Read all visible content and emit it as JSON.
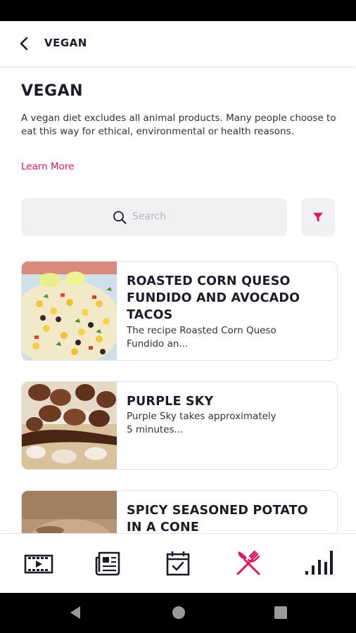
{
  "colors": {
    "accent": "#e0155f",
    "text": "#1b1c2a",
    "muted_field": "#f1f1f3"
  },
  "header": {
    "title": "VEGAN",
    "back_icon": "chevron-left-icon"
  },
  "page": {
    "title": "VEGAN",
    "description": "A vegan diet excludes all animal products. Many people choose to eat this way for ethical, environmental or health reasons.",
    "learn_more": "Learn More"
  },
  "search": {
    "placeholder": "Search",
    "icon": "search-icon",
    "filter_icon": "filter-icon"
  },
  "recipes": [
    {
      "title": "ROASTED CORN QUESO FUNDIDO AND AVOCADO TACOS",
      "description": "The recipe Roasted Corn Queso Fundido an...",
      "image": "corn-salad-photo"
    },
    {
      "title": "PURPLE SKY",
      "description": "Purple Sky takes approximately 5 minutes...",
      "image": "chocolate-dessert-photo"
    },
    {
      "title": "SPICY SEASONED POTATO IN A CONE",
      "description": "",
      "image": "potato-photo"
    }
  ],
  "bottom_nav": [
    {
      "name": "videos",
      "icon": "film-icon",
      "active": false
    },
    {
      "name": "news",
      "icon": "newspaper-icon",
      "active": false
    },
    {
      "name": "calendar",
      "icon": "calendar-check-icon",
      "active": false
    },
    {
      "name": "recipes",
      "icon": "fork-knife-icon",
      "active": true
    },
    {
      "name": "stats",
      "icon": "bar-chart-icon",
      "active": false
    }
  ],
  "system_nav": [
    "back-triangle-icon",
    "home-circle-icon",
    "recents-square-icon"
  ]
}
